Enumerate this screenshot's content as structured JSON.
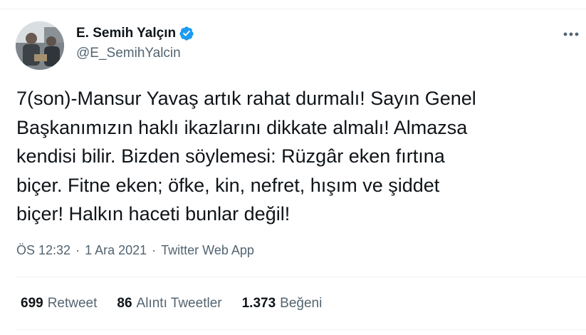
{
  "author": {
    "display_name": "E. Semih Yalçın",
    "handle": "@E_SemihYalcin",
    "verified": true,
    "avatar_icon": "avatar-photo"
  },
  "tweet": {
    "text": "7(son)-Mansur Yavaş artık rahat durmalı! Sayın Genel\nBaşkanımızın haklı ikazlarını dikkate almalı! Almazsa\nkendisi bilir. Bizden söylemesi: Rüzgâr eken fırtına\nbiçer. Fitne eken; öfke, kin, nefret, hışım ve şiddet\nbiçer! Halkın haceti bunlar değil!"
  },
  "meta": {
    "time": "ÖS 12:32",
    "date": "1 Ara 2021",
    "source": "Twitter Web App",
    "separator": "·"
  },
  "stats": {
    "retweets": {
      "count": "699",
      "label": "Retweet"
    },
    "quotes": {
      "count": "86",
      "label": "Alıntı Tweetler"
    },
    "likes": {
      "count": "1.373",
      "label": "Beğeni"
    }
  },
  "colors": {
    "verified_badge": "#1d9bf0",
    "secondary_text": "#536471",
    "primary_text": "#0f1419",
    "divider": "#eff3f4"
  },
  "icons": {
    "verified": "verified-badge-icon",
    "more": "more-dots-icon"
  }
}
